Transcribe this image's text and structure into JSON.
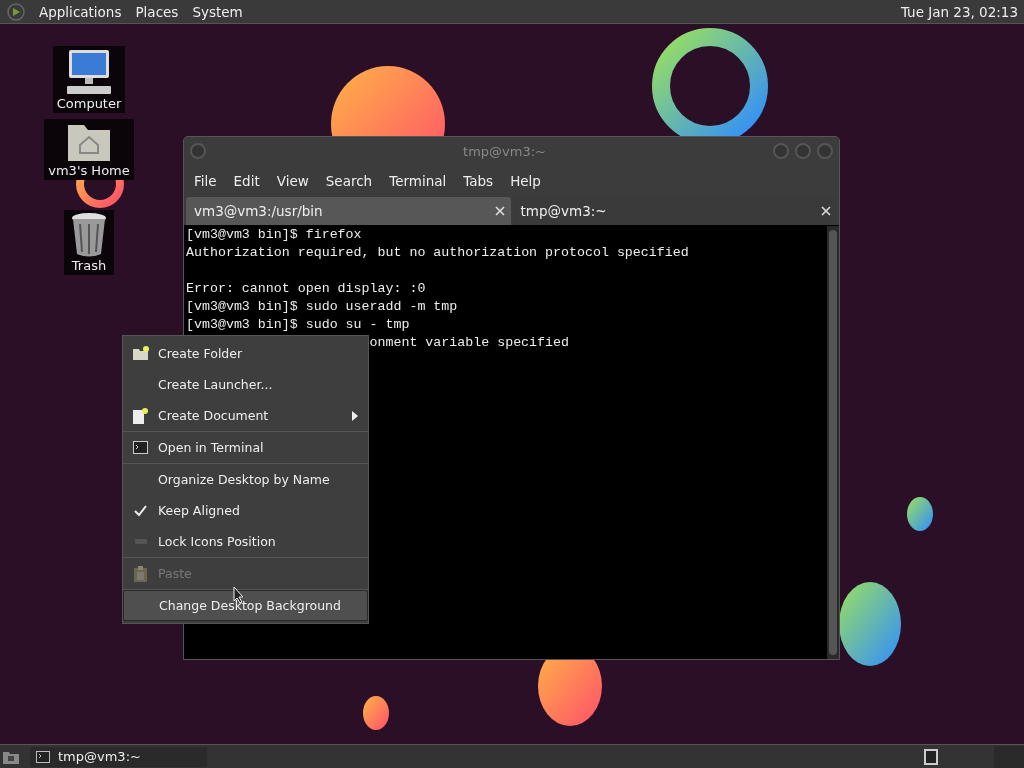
{
  "top_panel": {
    "menus": [
      "Applications",
      "Places",
      "System"
    ],
    "clock": "Tue Jan 23, 02:13"
  },
  "desktop_icons": [
    {
      "label": "Computer",
      "kind": "computer"
    },
    {
      "label": "vm3's Home",
      "kind": "home"
    },
    {
      "label": "Trash",
      "kind": "trash"
    }
  ],
  "terminal": {
    "title": "tmp@vm3:~",
    "menus": [
      "File",
      "Edit",
      "View",
      "Search",
      "Terminal",
      "Tabs",
      "Help"
    ],
    "tabs": [
      {
        "label": "vm3@vm3:/usr/bin",
        "selected": false
      },
      {
        "label": "tmp@vm3:~",
        "selected": true
      }
    ],
    "lines": [
      {
        "kind": "text",
        "text": "[vm3@vm3 bin]$ firefox"
      },
      {
        "kind": "text",
        "text": "Authorization required, but no authorization protocol specified"
      },
      {
        "kind": "blank"
      },
      {
        "kind": "text",
        "text": "Error: cannot open display: :0"
      },
      {
        "kind": "text",
        "text": "[vm3@vm3 bin]$ sudo useradd -m tmp"
      },
      {
        "kind": "text",
        "text": "[vm3@vm3 bin]$ sudo su - tmp"
      },
      {
        "kind": "covered",
        "text": "onment variable specified"
      }
    ]
  },
  "context_menu": {
    "items": [
      {
        "label": "Create Folder",
        "kind": "folder",
        "disabled": false,
        "selected": false,
        "submenu": false,
        "separator_after": false
      },
      {
        "label": "Create Launcher...",
        "kind": "plain",
        "disabled": false,
        "selected": false,
        "submenu": false,
        "separator_after": false
      },
      {
        "label": "Create Document",
        "kind": "document",
        "disabled": false,
        "selected": false,
        "submenu": true,
        "separator_after": true
      },
      {
        "label": "Open in Terminal",
        "kind": "terminal",
        "disabled": false,
        "selected": false,
        "submenu": false,
        "separator_after": true
      },
      {
        "label": "Organize Desktop by Name",
        "kind": "plain",
        "disabled": false,
        "selected": false,
        "submenu": false,
        "separator_after": false
      },
      {
        "label": "Keep Aligned",
        "kind": "check",
        "checked": true,
        "disabled": false,
        "selected": false,
        "submenu": false,
        "separator_after": false
      },
      {
        "label": "Lock Icons Position",
        "kind": "lock",
        "disabled": false,
        "selected": false,
        "submenu": false,
        "separator_after": true
      },
      {
        "label": "Paste",
        "kind": "paste",
        "disabled": true,
        "selected": false,
        "submenu": false,
        "separator_after": true
      },
      {
        "label": "Change Desktop Background",
        "kind": "plain",
        "disabled": false,
        "selected": true,
        "submenu": false,
        "separator_after": false
      }
    ]
  },
  "taskbar": {
    "tasks": [
      {
        "label": "tmp@vm3:~",
        "selected": false
      }
    ]
  }
}
